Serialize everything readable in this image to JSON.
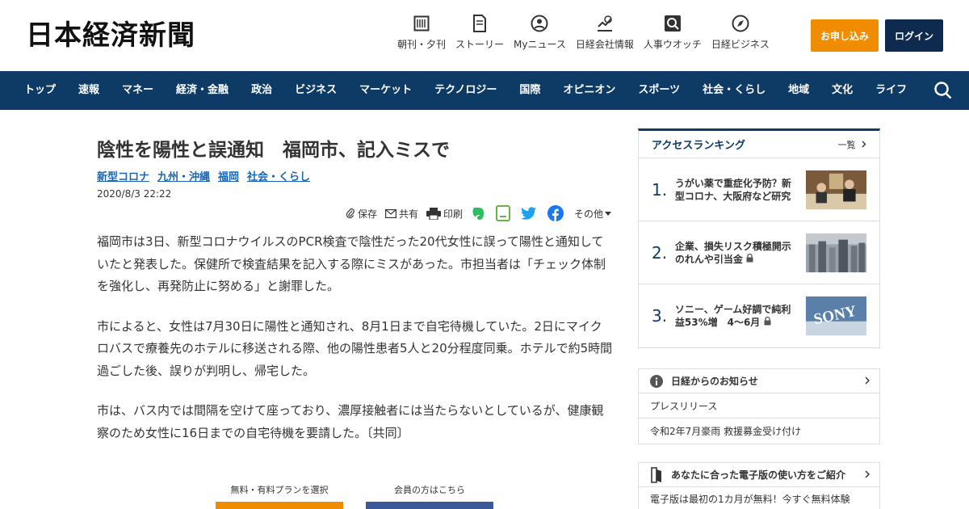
{
  "header": {
    "logo": "日本経済新聞",
    "nav": [
      {
        "label": "朝刊・夕刊",
        "icon": "newspaper-icon"
      },
      {
        "label": "ストーリー",
        "icon": "document-icon"
      },
      {
        "label": "Myニュース",
        "icon": "person-icon"
      },
      {
        "label": "日経会社情報",
        "icon": "chart-icon"
      },
      {
        "label": "人事ウオッチ",
        "icon": "search-person-icon"
      },
      {
        "label": "日経ビジネス",
        "icon": "compass-icon"
      }
    ],
    "apply_label": "お申し込み",
    "login_label": "ログイン"
  },
  "mainnav": [
    "トップ",
    "速報",
    "マネー",
    "経済・金融",
    "政治",
    "ビジネス",
    "マーケット",
    "テクノロジー",
    "国際",
    "オピニオン",
    "スポーツ",
    "社会・くらし",
    "地域",
    "文化",
    "ライフ"
  ],
  "article": {
    "title": "陰性を陽性と誤通知　福岡市、記入ミスで",
    "tags": [
      "新型コロナ",
      "九州・沖縄",
      "福岡",
      "社会・くらし"
    ],
    "date": "2020/8/3 22:22",
    "tools": {
      "save": "保存",
      "share": "共有",
      "print": "印刷",
      "more": "その他"
    },
    "paragraphs": [
      "福岡市は3日、新型コロナウイルスのPCR検査で陰性だった20代女性に誤って陽性と通知していたと発表した。保健所で検査結果を記入する際にミスがあった。市担当者は「チェック体制を強化し、再発防止に努める」と謝罪した。",
      "市によると、女性は7月30日に陽性と通知され、8月1日まで自宅待機していた。2日にマイクロバスで療養先のホテルに移送される際、他の陽性患者5人と20分程度同乗。ホテルで約5時間過ごした後、誤りが判明し、帰宅した。",
      "市は、バス内では間隔を空けて座っており、濃厚接触者には当たらないとしているが、健康観察のため女性に16日までの自宅待機を要請した。〔共同〕"
    ],
    "cta": {
      "plan": "無料・有料プランを選択",
      "member": "会員の方はこちら"
    }
  },
  "ranking": {
    "title": "アクセスランキング",
    "more": "一覧",
    "items": [
      {
        "rank": "1.",
        "text": "うがい薬で重症化予防？新型コロナ、大阪府など研究"
      },
      {
        "rank": "2.",
        "text": "企業、損失リスク積極開示　のれんや引当金"
      },
      {
        "rank": "3.",
        "text": "ソニー、ゲーム好調で純利益53%増　4～6月"
      }
    ],
    "thumb3_text": "SONY"
  },
  "notice": {
    "title": "日経からのお知らせ",
    "rows": [
      "プレスリリース",
      "令和2年7月豪雨 救援募金受け付け"
    ]
  },
  "epaper": {
    "title": "あなたに合った電子版の使い方をご紹介",
    "row": "電子版は最初の1カ月が無料！今すぐ無料体験"
  },
  "colors": {
    "brand": "#0e3a66",
    "accent": "#f08c00",
    "link": "#1a66b3"
  }
}
